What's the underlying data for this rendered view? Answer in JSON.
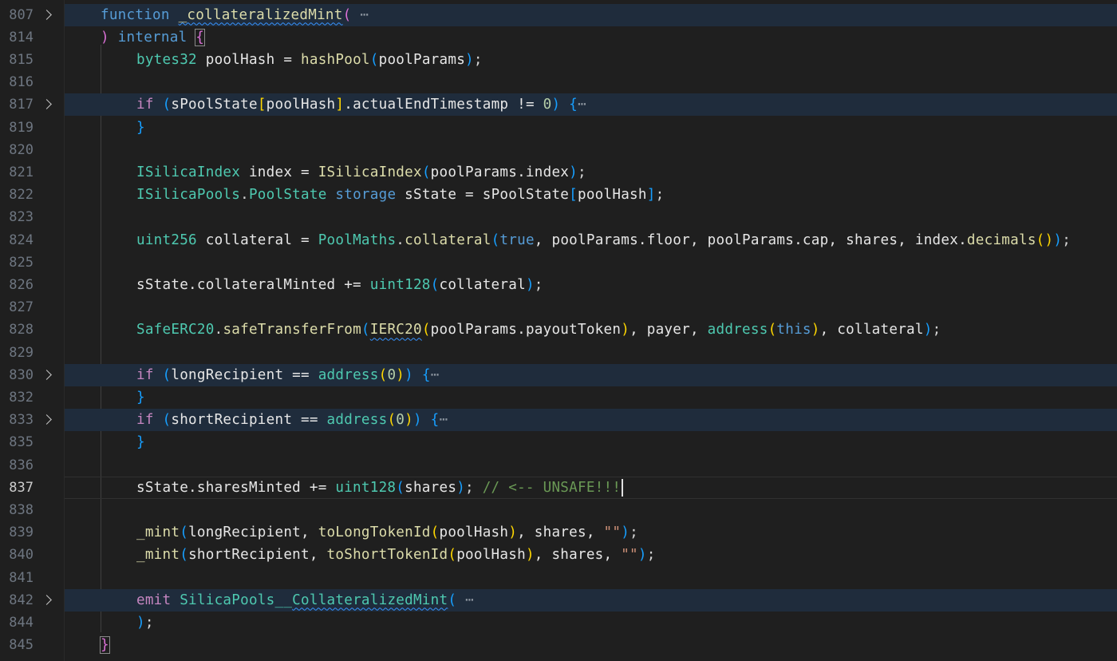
{
  "editor": {
    "language": "solidity",
    "current_line": "837",
    "colors": {
      "background": "#1f1f1f",
      "folded_highlight": "#1f2c3c",
      "keyword": "#569cd6",
      "control": "#c586c0",
      "function": "#dcdcaa",
      "type": "#4ec9b0",
      "comment": "#6a9955"
    },
    "lines": [
      {
        "n": "807",
        "folded": true,
        "indent": 0,
        "tokens": [
          {
            "t": "function ",
            "c": "kw"
          },
          {
            "t": "_collateralizedMint",
            "c": "fn squig"
          },
          {
            "t": "(",
            "c": "p2"
          },
          {
            "t": " ⋯",
            "c": "ell"
          }
        ]
      },
      {
        "n": "814",
        "indent": 0,
        "tokens": [
          {
            "t": ") ",
            "c": "p2"
          },
          {
            "t": "internal",
            "c": "kw"
          },
          {
            "t": " ",
            "c": "op"
          },
          {
            "t": "{",
            "c": "p2 bm"
          }
        ]
      },
      {
        "n": "815",
        "indent": 1,
        "tokens": [
          {
            "t": "bytes32",
            "c": "ty"
          },
          {
            "t": " poolHash = ",
            "c": "var"
          },
          {
            "t": "hashPool",
            "c": "fn"
          },
          {
            "t": "(",
            "c": "p3"
          },
          {
            "t": "poolParams",
            "c": "var"
          },
          {
            "t": ")",
            "c": "p3"
          },
          {
            "t": ";",
            "c": "op"
          }
        ]
      },
      {
        "n": "816",
        "indent": 1,
        "tokens": []
      },
      {
        "n": "817",
        "folded": true,
        "indent": 1,
        "tokens": [
          {
            "t": "if",
            "c": "ctl"
          },
          {
            "t": " ",
            "c": "op"
          },
          {
            "t": "(",
            "c": "p3"
          },
          {
            "t": "sPoolState",
            "c": "var"
          },
          {
            "t": "[",
            "c": "p1"
          },
          {
            "t": "poolHash",
            "c": "var"
          },
          {
            "t": "]",
            "c": "p1"
          },
          {
            "t": ".actualEndTimestamp != ",
            "c": "var"
          },
          {
            "t": "0",
            "c": "num"
          },
          {
            "t": ")",
            "c": "p3"
          },
          {
            "t": " ",
            "c": "op"
          },
          {
            "t": "{",
            "c": "p3"
          },
          {
            "t": "⋯",
            "c": "ell"
          }
        ]
      },
      {
        "n": "819",
        "indent": 1,
        "tokens": [
          {
            "t": "}",
            "c": "p3"
          }
        ]
      },
      {
        "n": "820",
        "indent": 1,
        "tokens": []
      },
      {
        "n": "821",
        "indent": 1,
        "tokens": [
          {
            "t": "ISilicaIndex",
            "c": "ty"
          },
          {
            "t": " index = ",
            "c": "var"
          },
          {
            "t": "ISilicaIndex",
            "c": "fn"
          },
          {
            "t": "(",
            "c": "p3"
          },
          {
            "t": "poolParams.index",
            "c": "var"
          },
          {
            "t": ")",
            "c": "p3"
          },
          {
            "t": ";",
            "c": "op"
          }
        ]
      },
      {
        "n": "822",
        "indent": 1,
        "tokens": [
          {
            "t": "ISilicaPools",
            "c": "ty"
          },
          {
            "t": ".",
            "c": "op"
          },
          {
            "t": "PoolState",
            "c": "ty"
          },
          {
            "t": " storage",
            "c": "kw"
          },
          {
            "t": " sState = sPoolState",
            "c": "var"
          },
          {
            "t": "[",
            "c": "p3"
          },
          {
            "t": "poolHash",
            "c": "var"
          },
          {
            "t": "]",
            "c": "p3"
          },
          {
            "t": ";",
            "c": "op"
          }
        ]
      },
      {
        "n": "823",
        "indent": 1,
        "tokens": []
      },
      {
        "n": "824",
        "indent": 1,
        "tokens": [
          {
            "t": "uint256",
            "c": "ty"
          },
          {
            "t": " collateral = ",
            "c": "var"
          },
          {
            "t": "PoolMaths",
            "c": "ty"
          },
          {
            "t": ".",
            "c": "op"
          },
          {
            "t": "collateral",
            "c": "fn"
          },
          {
            "t": "(",
            "c": "p3"
          },
          {
            "t": "true",
            "c": "kw"
          },
          {
            "t": ", poolParams.floor, poolParams.cap, shares, index.",
            "c": "var"
          },
          {
            "t": "decimals",
            "c": "fn"
          },
          {
            "t": "(",
            "c": "p1"
          },
          {
            "t": ")",
            "c": "p1"
          },
          {
            "t": ")",
            "c": "p3"
          },
          {
            "t": ";",
            "c": "op"
          }
        ]
      },
      {
        "n": "825",
        "indent": 1,
        "tokens": []
      },
      {
        "n": "826",
        "indent": 1,
        "tokens": [
          {
            "t": "sState.collateralMinted += ",
            "c": "var"
          },
          {
            "t": "uint128",
            "c": "ty"
          },
          {
            "t": "(",
            "c": "p3"
          },
          {
            "t": "collateral",
            "c": "var"
          },
          {
            "t": ")",
            "c": "p3"
          },
          {
            "t": ";",
            "c": "op"
          }
        ]
      },
      {
        "n": "827",
        "indent": 1,
        "tokens": []
      },
      {
        "n": "828",
        "indent": 1,
        "tokens": [
          {
            "t": "SafeERC20",
            "c": "ty"
          },
          {
            "t": ".",
            "c": "op"
          },
          {
            "t": "safeTransferFrom",
            "c": "fn"
          },
          {
            "t": "(",
            "c": "p3"
          },
          {
            "t": "IERC20",
            "c": "fn squig"
          },
          {
            "t": "(",
            "c": "p1"
          },
          {
            "t": "poolParams.payoutToken",
            "c": "var"
          },
          {
            "t": ")",
            "c": "p1"
          },
          {
            "t": ", payer, ",
            "c": "var"
          },
          {
            "t": "address",
            "c": "ty"
          },
          {
            "t": "(",
            "c": "p1"
          },
          {
            "t": "this",
            "c": "kw"
          },
          {
            "t": ")",
            "c": "p1"
          },
          {
            "t": ", collateral",
            "c": "var"
          },
          {
            "t": ")",
            "c": "p3"
          },
          {
            "t": ";",
            "c": "op"
          }
        ]
      },
      {
        "n": "829",
        "indent": 1,
        "tokens": []
      },
      {
        "n": "830",
        "folded": true,
        "indent": 1,
        "tokens": [
          {
            "t": "if",
            "c": "ctl"
          },
          {
            "t": " ",
            "c": "op"
          },
          {
            "t": "(",
            "c": "p3"
          },
          {
            "t": "longRecipient == ",
            "c": "var"
          },
          {
            "t": "address",
            "c": "ty"
          },
          {
            "t": "(",
            "c": "p1"
          },
          {
            "t": "0",
            "c": "num"
          },
          {
            "t": ")",
            "c": "p1"
          },
          {
            "t": ")",
            "c": "p3"
          },
          {
            "t": " ",
            "c": "op"
          },
          {
            "t": "{",
            "c": "p3"
          },
          {
            "t": "⋯",
            "c": "ell"
          }
        ]
      },
      {
        "n": "832",
        "indent": 1,
        "tokens": [
          {
            "t": "}",
            "c": "p3"
          }
        ]
      },
      {
        "n": "833",
        "folded": true,
        "indent": 1,
        "tokens": [
          {
            "t": "if",
            "c": "ctl"
          },
          {
            "t": " ",
            "c": "op"
          },
          {
            "t": "(",
            "c": "p3"
          },
          {
            "t": "shortRecipient == ",
            "c": "var"
          },
          {
            "t": "address",
            "c": "ty"
          },
          {
            "t": "(",
            "c": "p1"
          },
          {
            "t": "0",
            "c": "num"
          },
          {
            "t": ")",
            "c": "p1"
          },
          {
            "t": ")",
            "c": "p3"
          },
          {
            "t": " ",
            "c": "op"
          },
          {
            "t": "{",
            "c": "p3"
          },
          {
            "t": "⋯",
            "c": "ell"
          }
        ]
      },
      {
        "n": "835",
        "indent": 1,
        "tokens": [
          {
            "t": "}",
            "c": "p3"
          }
        ]
      },
      {
        "n": "836",
        "indent": 1,
        "tokens": []
      },
      {
        "n": "837",
        "current": true,
        "indent": 1,
        "tokens": [
          {
            "t": "sState.sharesMinted += ",
            "c": "var"
          },
          {
            "t": "uint128",
            "c": "ty"
          },
          {
            "t": "(",
            "c": "p3"
          },
          {
            "t": "shares",
            "c": "var"
          },
          {
            "t": ")",
            "c": "p3"
          },
          {
            "t": "; ",
            "c": "op"
          },
          {
            "t": "// <-- UNSAFE!!!",
            "c": "cmt"
          }
        ]
      },
      {
        "n": "838",
        "indent": 1,
        "tokens": []
      },
      {
        "n": "839",
        "indent": 1,
        "tokens": [
          {
            "t": "_mint",
            "c": "fn"
          },
          {
            "t": "(",
            "c": "p3"
          },
          {
            "t": "longRecipient, ",
            "c": "var"
          },
          {
            "t": "toLongTokenId",
            "c": "fn"
          },
          {
            "t": "(",
            "c": "p1"
          },
          {
            "t": "poolHash",
            "c": "var"
          },
          {
            "t": ")",
            "c": "p1"
          },
          {
            "t": ", shares, ",
            "c": "var"
          },
          {
            "t": "\"\"",
            "c": "str"
          },
          {
            "t": ")",
            "c": "p3"
          },
          {
            "t": ";",
            "c": "op"
          }
        ]
      },
      {
        "n": "840",
        "indent": 1,
        "tokens": [
          {
            "t": "_mint",
            "c": "fn"
          },
          {
            "t": "(",
            "c": "p3"
          },
          {
            "t": "shortRecipient, ",
            "c": "var"
          },
          {
            "t": "toShortTokenId",
            "c": "fn"
          },
          {
            "t": "(",
            "c": "p1"
          },
          {
            "t": "poolHash",
            "c": "var"
          },
          {
            "t": ")",
            "c": "p1"
          },
          {
            "t": ", shares, ",
            "c": "var"
          },
          {
            "t": "\"\"",
            "c": "str"
          },
          {
            "t": ")",
            "c": "p3"
          },
          {
            "t": ";",
            "c": "op"
          }
        ]
      },
      {
        "n": "841",
        "indent": 1,
        "tokens": []
      },
      {
        "n": "842",
        "folded": true,
        "indent": 1,
        "tokens": [
          {
            "t": "emit",
            "c": "ctl"
          },
          {
            "t": " ",
            "c": "op"
          },
          {
            "t": "SilicaPools__",
            "c": "ty"
          },
          {
            "t": "CollateralizedMint",
            "c": "ty squig"
          },
          {
            "t": "(",
            "c": "p3"
          },
          {
            "t": " ⋯",
            "c": "ell"
          }
        ]
      },
      {
        "n": "844",
        "indent": 1,
        "tokens": [
          {
            "t": ")",
            "c": "p3"
          },
          {
            "t": ";",
            "c": "op"
          }
        ]
      },
      {
        "n": "845",
        "indent": 0,
        "tokens": [
          {
            "t": "}",
            "c": "p2 bm"
          }
        ]
      }
    ]
  }
}
